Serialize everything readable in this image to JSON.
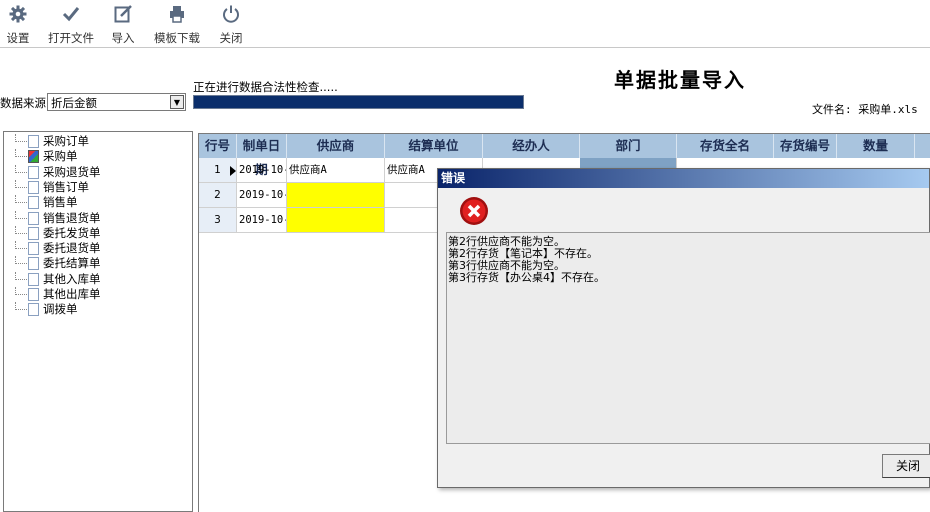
{
  "toolbar": {
    "items": [
      {
        "label": "设置",
        "icon": "gear-icon"
      },
      {
        "label": "打开文件",
        "icon": "checkmark-icon"
      },
      {
        "label": "导入",
        "icon": "edit-icon"
      },
      {
        "label": "模板下载",
        "icon": "printer-icon"
      },
      {
        "label": "关闭",
        "icon": "power-icon"
      }
    ]
  },
  "header": {
    "title": "单据批量导入",
    "filename": "文件名: 采购单.xls",
    "checking_text": "正在进行数据合法性检查.....",
    "progress_fraction": 1.0
  },
  "source": {
    "label": "数据来源",
    "value": "折后金额"
  },
  "tree": {
    "items": [
      "采购订单",
      "采购单",
      "采购退货单",
      "销售订单",
      "销售单",
      "销售退货单",
      "委托发货单",
      "委托退货单",
      "委托结算单",
      "其他入库单",
      "其他出库单",
      "调拨单"
    ],
    "selected_index": 1
  },
  "grid": {
    "columns": [
      "行号",
      "制单日期",
      "供应商",
      "结算单位",
      "经办人",
      "部门",
      "存货全名",
      "存货编号",
      "数量"
    ],
    "rows": [
      {
        "no": "1",
        "date": "2019-10-",
        "supplier": "供应商A",
        "settle": "供应商A"
      },
      {
        "no": "2",
        "date": "2019-10-",
        "supplier": "",
        "settle": ""
      },
      {
        "no": "3",
        "date": "2019-10-",
        "supplier": "",
        "settle": ""
      }
    ]
  },
  "dialog": {
    "title": "错误",
    "messages": [
      "第2行供应商不能为空。",
      "第2行存货【笔记本】不存在。",
      "第3行供应商不能为空。",
      "第3行存货【办公桌4】不存在。"
    ],
    "close_label": "关闭"
  },
  "colors": {
    "progress": "#0b2e6b",
    "grid_header": "#a9c4de",
    "invalid_cell": "#ffff00",
    "dialog_title": "#0a246a"
  }
}
